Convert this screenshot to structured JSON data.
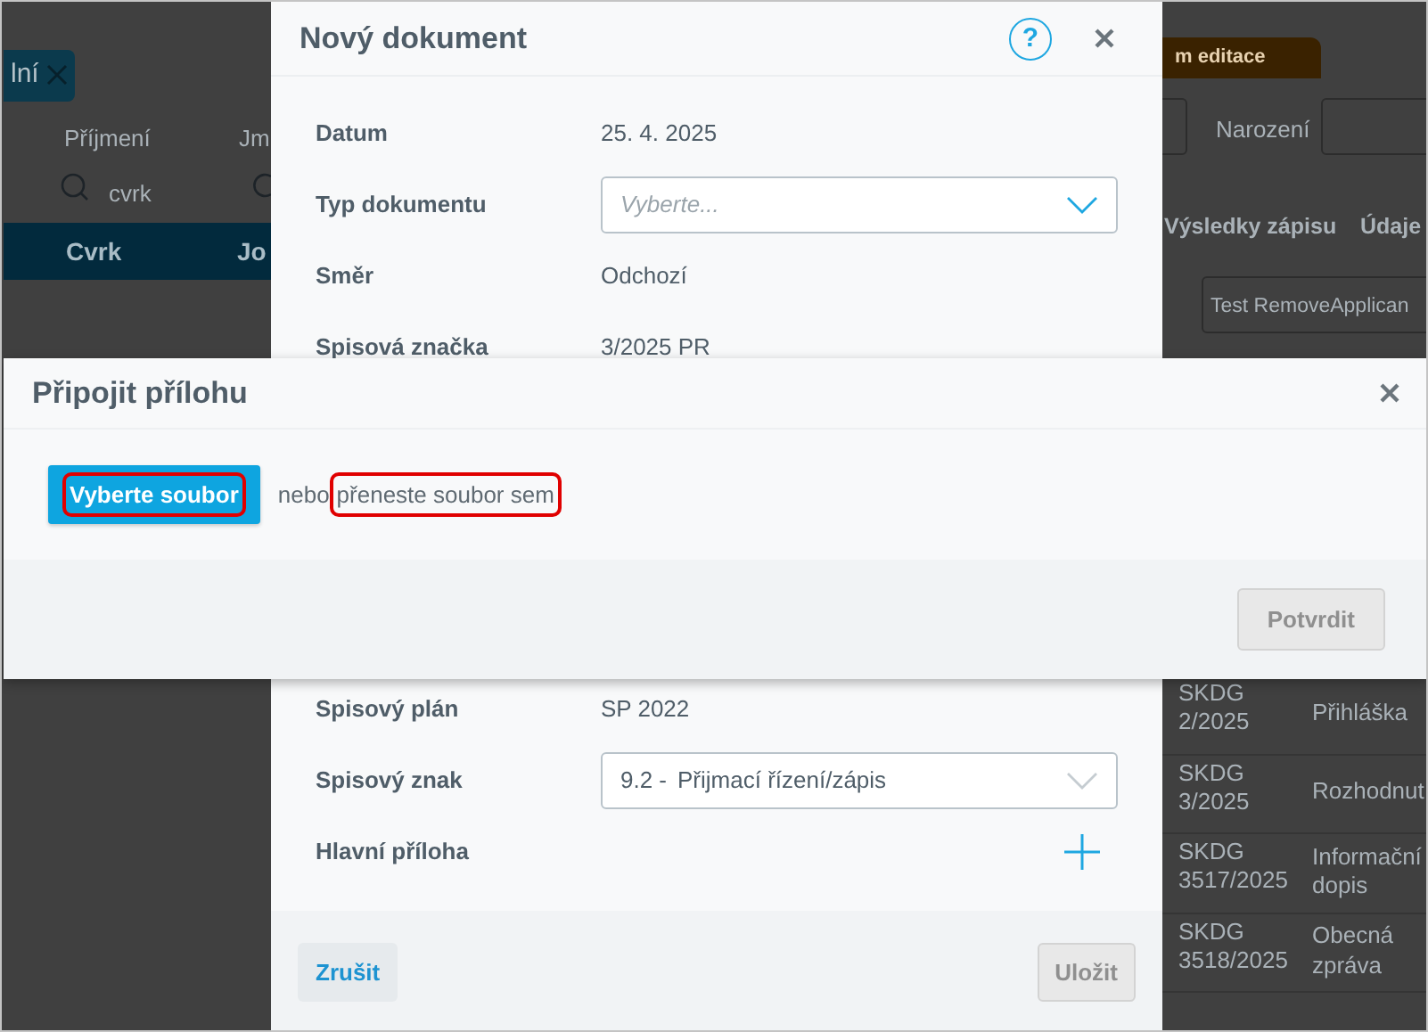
{
  "background": {
    "filter_chip": {
      "label": "lní"
    },
    "columns": [
      "Příjmení",
      "Jm"
    ],
    "search_value": "cvrk",
    "selected_row": [
      "Cvrk",
      "Jo"
    ],
    "tab": {
      "label": "m editace",
      "selected": true
    },
    "birth_label": "Narození",
    "section_tabs": [
      "Výsledky zápisu",
      "Údaje"
    ],
    "select_value": "Test RemoveApplican",
    "rows": [
      {
        "number": "SKDG 2/2025",
        "type": "Přihláška"
      },
      {
        "number": "SKDG 3/2025",
        "type": "Rozhodnut"
      },
      {
        "number": "SKDG 3517/2025",
        "type": "Informační dopis"
      },
      {
        "number": "SKDG 3518/2025",
        "type": "Obecná zpráva"
      }
    ]
  },
  "document_dialog": {
    "title": "Nový dokument",
    "help_label": "?",
    "fields_top": [
      {
        "label": "Datum",
        "kind": "text",
        "value": "25. 4. 2025"
      },
      {
        "label": "Typ dokumentu",
        "kind": "select",
        "placeholder": "Vyberte..."
      },
      {
        "label": "Směr",
        "kind": "text",
        "value": "Odchozí"
      },
      {
        "label": "Spisová značka",
        "kind": "text",
        "value": "3/2025 PR"
      }
    ],
    "fields_bottom": [
      {
        "label": "Spisový plán",
        "kind": "text",
        "value": "SP 2022"
      },
      {
        "label": "Spisový znak",
        "kind": "select",
        "code": "9.2 -",
        "value": "Přijmací řízení/zápis"
      },
      {
        "label": "Hlavní příloha",
        "kind": "add"
      }
    ],
    "buttons": [
      {
        "label": "Zrušit",
        "disabled": false
      },
      {
        "label": "Uložit",
        "disabled": true
      }
    ]
  },
  "attach_dialog": {
    "title": "Připojit přílohu",
    "choose_button": {
      "label": "Vyberte soubor",
      "highlighted": true
    },
    "or_text": "nebo",
    "drop_text": {
      "label": "přeneste soubor sem",
      "highlighted": true
    },
    "confirm_button": {
      "label": "Potvrdit",
      "disabled": true
    }
  }
}
